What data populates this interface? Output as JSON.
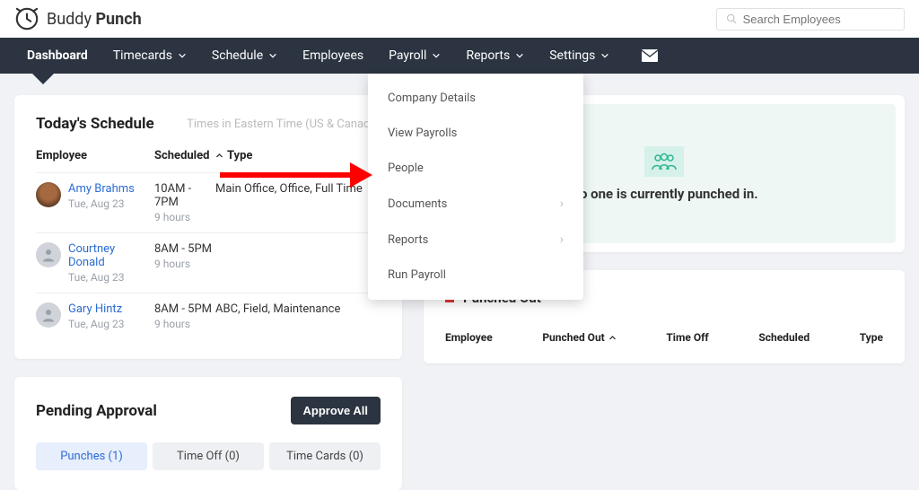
{
  "brand": {
    "name_light": "Buddy",
    "name_bold": "Punch"
  },
  "search": {
    "placeholder": "Search Employees"
  },
  "nav": {
    "dashboard": "Dashboard",
    "timecards": "Timecards",
    "schedule": "Schedule",
    "employees": "Employees",
    "payroll": "Payroll",
    "reports": "Reports",
    "settings": "Settings"
  },
  "dropdown": {
    "company_details": "Company Details",
    "view_payrolls": "View Payrolls",
    "people": "People",
    "documents": "Documents",
    "reports": "Reports",
    "run_payroll": "Run Payroll"
  },
  "schedule_card": {
    "title": "Today's Schedule",
    "timezone": "Times in Eastern Time (US & Canada)",
    "head_employee": "Employee",
    "head_scheduled": "Scheduled",
    "head_type": "Type",
    "rows": [
      {
        "name": "Amy Brahms",
        "date": "Tue, Aug 23",
        "time": "10AM - 7PM",
        "hours": "9 hours",
        "type": "Main Office, Office, Full Time"
      },
      {
        "name": "Courtney Donald",
        "date": "Tue, Aug 23",
        "time": "8AM - 5PM",
        "hours": "9 hours",
        "type": ""
      },
      {
        "name": "Gary Hintz",
        "date": "Tue, Aug 23",
        "time": "8AM - 5PM",
        "hours": "9 hours",
        "type": "ABC, Field, Maintenance"
      }
    ]
  },
  "punched_in": {
    "empty": "No one is currently punched in."
  },
  "pending": {
    "title": "Pending Approval",
    "approve_all": "Approve All",
    "tab_punches": "Punches (1)",
    "tab_timeoff": "Time Off (0)",
    "tab_timecards": "Time Cards (0)"
  },
  "punched_out": {
    "title": "Punched Out",
    "col_employee": "Employee",
    "col_punched_out": "Punched Out",
    "col_time_off": "Time Off",
    "col_scheduled": "Scheduled",
    "col_type": "Type"
  }
}
